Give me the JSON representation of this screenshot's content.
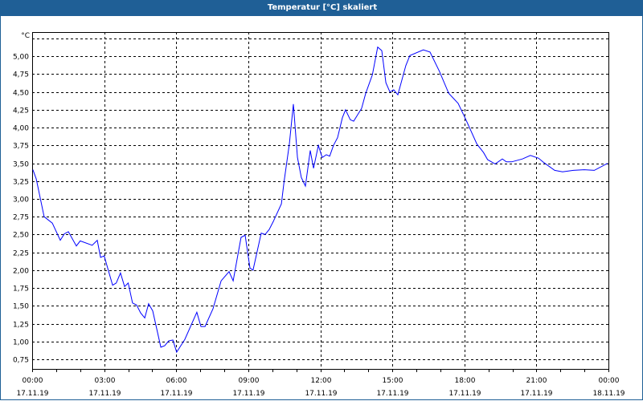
{
  "window": {
    "title": "Temperatur [°C] skaliert"
  },
  "chart_data": {
    "type": "line",
    "title": "Temperatur [°C] skaliert",
    "ylabel": "°C",
    "xlabel": "",
    "ylim": [
      0.615,
      5.34
    ],
    "xlim_hours": [
      0,
      24
    ],
    "grid": true,
    "line_color": "#0000ff",
    "y_ticks": [
      0.75,
      1.0,
      1.25,
      1.5,
      1.75,
      2.0,
      2.25,
      2.5,
      2.75,
      3.0,
      3.25,
      3.5,
      3.75,
      4.0,
      4.25,
      4.5,
      4.75,
      5.0,
      5.25
    ],
    "y_tick_labels": [
      "0,75",
      "1,00",
      "1,25",
      "1,50",
      "1,75",
      "2,00",
      "2,25",
      "2,50",
      "2,75",
      "3,00",
      "3,25",
      "3,50",
      "3,75",
      "4,00",
      "4,25",
      "4,50",
      "4,75",
      "5,00",
      ""
    ],
    "x_ticks": [
      {
        "hour": 0,
        "time": "00:00",
        "date": "17.11.19"
      },
      {
        "hour": 3,
        "time": "03:00",
        "date": "17.11.19"
      },
      {
        "hour": 6,
        "time": "06:00",
        "date": "17.11.19"
      },
      {
        "hour": 9,
        "time": "09:00",
        "date": "17.11.19"
      },
      {
        "hour": 12,
        "time": "12:00",
        "date": "17.11.19"
      },
      {
        "hour": 15,
        "time": "15:00",
        "date": "17.11.19"
      },
      {
        "hour": 18,
        "time": "18:00",
        "date": "17.11.19"
      },
      {
        "hour": 21,
        "time": "21:00",
        "date": "17.11.19"
      },
      {
        "hour": 24,
        "time": "00:00",
        "date": "18.11.19"
      }
    ],
    "series": [
      {
        "name": "Temperatur",
        "x_hours": [
          0.03,
          0.17,
          0.5,
          0.84,
          1.17,
          1.34,
          1.51,
          1.84,
          2.0,
          2.5,
          2.71,
          2.85,
          3.0,
          3.35,
          3.5,
          3.68,
          3.85,
          4.0,
          4.18,
          4.35,
          4.52,
          4.69,
          4.85,
          5.02,
          5.36,
          5.52,
          5.69,
          5.86,
          6.02,
          6.36,
          6.86,
          7.03,
          7.2,
          7.53,
          7.87,
          8.2,
          8.37,
          8.7,
          8.87,
          9.07,
          9.2,
          9.54,
          9.7,
          9.87,
          10.04,
          10.38,
          10.49,
          10.71,
          10.88,
          11.05,
          11.21,
          11.38,
          11.58,
          11.72,
          11.92,
          12.08,
          12.25,
          12.39,
          12.55,
          12.72,
          12.92,
          13.05,
          13.25,
          13.39,
          13.72,
          13.89,
          14.17,
          14.39,
          14.56,
          14.73,
          14.9,
          15.06,
          15.23,
          15.56,
          15.73,
          16.29,
          16.57,
          16.96,
          17.35,
          17.74,
          18.08,
          18.52,
          18.8,
          18.97,
          19.28,
          19.58,
          19.75,
          19.97,
          20.42,
          20.75,
          21.09,
          21.31,
          21.76,
          22.09,
          22.54,
          22.99,
          23.41,
          23.97
        ],
        "values": [
          3.41,
          3.28,
          2.75,
          2.66,
          2.42,
          2.51,
          2.54,
          2.34,
          2.41,
          2.35,
          2.42,
          2.18,
          2.2,
          1.79,
          1.82,
          1.96,
          1.77,
          1.82,
          1.54,
          1.51,
          1.4,
          1.33,
          1.53,
          1.43,
          0.92,
          0.94,
          1.01,
          1.02,
          0.85,
          1.03,
          1.41,
          1.21,
          1.21,
          1.46,
          1.85,
          1.98,
          1.85,
          2.46,
          2.49,
          2.03,
          2.0,
          2.52,
          2.5,
          2.57,
          2.68,
          2.93,
          3.24,
          3.77,
          4.33,
          3.58,
          3.3,
          3.18,
          3.68,
          3.43,
          3.75,
          3.58,
          3.62,
          3.6,
          3.75,
          3.86,
          4.14,
          4.25,
          4.11,
          4.09,
          4.27,
          4.48,
          4.74,
          5.13,
          5.08,
          4.63,
          4.5,
          4.53,
          4.46,
          4.87,
          5.01,
          5.09,
          5.06,
          4.79,
          4.48,
          4.34,
          4.1,
          3.77,
          3.65,
          3.55,
          3.49,
          3.56,
          3.52,
          3.52,
          3.56,
          3.61,
          3.57,
          3.51,
          3.4,
          3.38,
          3.4,
          3.41,
          3.4,
          3.5
        ]
      }
    ]
  }
}
